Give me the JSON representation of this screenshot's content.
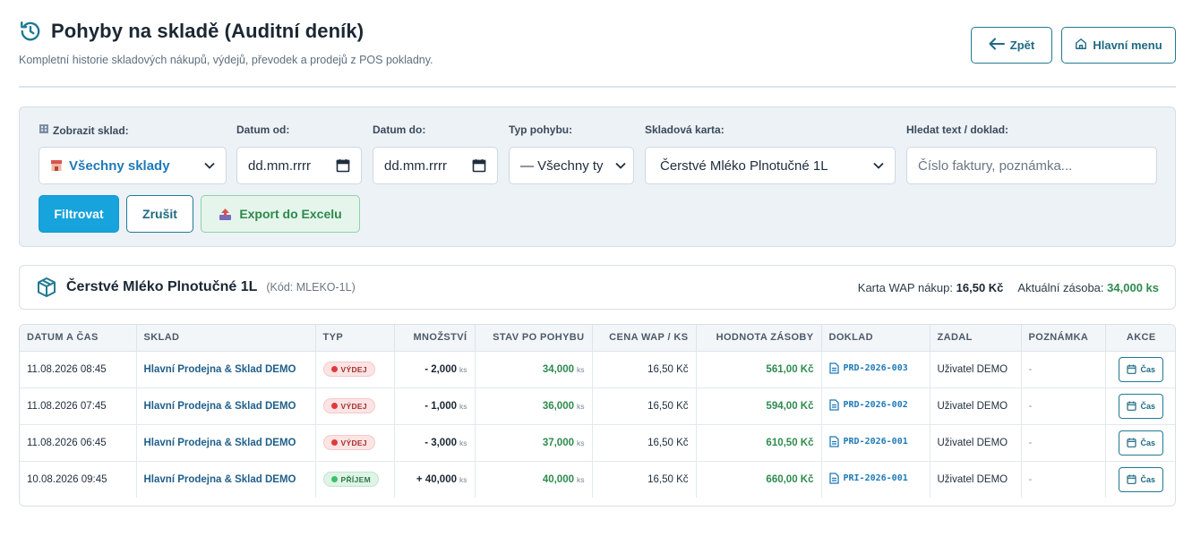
{
  "header": {
    "title": "Pohyby na skladě (Auditní deník)",
    "subtitle": "Kompletní historie skladových nákupů, výdejů, převodek a prodejů z POS pokladny.",
    "back_label": "Zpět",
    "home_label": "Hlavní menu"
  },
  "filters": {
    "store_label": "Zobrazit sklad:",
    "store_value": "Všechny sklady",
    "date_from_label": "Datum od:",
    "date_from_value": "dd.mm.rrrr",
    "date_to_label": "Datum do:",
    "date_to_value": "dd.mm.rrrr",
    "type_label": "Typ pohybu:",
    "type_value": "— Všechny ty",
    "card_label": "Skladová karta:",
    "card_value": "Čerstvé Mléko Plnotučné 1L",
    "search_label": "Hledat text / doklad:",
    "search_placeholder": "Číslo faktury, poznámka...",
    "filter_button": "Filtrovat",
    "cancel_button": "Zrušit",
    "export_button": "Export do Excelu"
  },
  "item": {
    "name": "Čerstvé Mléko Plnotučné 1L",
    "code": "(Kód: MLEKO-1L)",
    "wap_label": "Karta WAP nákup:",
    "wap_value": "16,50 Kč",
    "stock_label": "Aktuální zásoba:",
    "stock_value": "34,000 ks"
  },
  "table": {
    "headers": [
      "DATUM A ČAS",
      "SKLAD",
      "TYP",
      "MNOŽSTVÍ",
      "STAV PO POHYBU",
      "CENA WAP / KS",
      "HODNOTA ZÁSOBY",
      "DOKLAD",
      "ZADAL",
      "POZNÁMKA",
      "AKCE"
    ],
    "unit": "ks",
    "action_label": "Čas",
    "rows": [
      {
        "datetime": "11.08.2026 08:45",
        "store": "Hlavní Prodejna & Sklad DEMO",
        "type": "VÝDEJ",
        "qty": "- 2,000",
        "balance": "34,000",
        "wap": "16,50 Kč",
        "value": "561,00 Kč",
        "doc": "PRD-2026-003",
        "user": "Uživatel DEMO",
        "note": "-"
      },
      {
        "datetime": "11.08.2026 07:45",
        "store": "Hlavní Prodejna & Sklad DEMO",
        "type": "VÝDEJ",
        "qty": "- 1,000",
        "balance": "36,000",
        "wap": "16,50 Kč",
        "value": "594,00 Kč",
        "doc": "PRD-2026-002",
        "user": "Uživatel DEMO",
        "note": "-"
      },
      {
        "datetime": "11.08.2026 06:45",
        "store": "Hlavní Prodejna & Sklad DEMO",
        "type": "VÝDEJ",
        "qty": "- 3,000",
        "balance": "37,000",
        "wap": "16,50 Kč",
        "value": "610,50 Kč",
        "doc": "PRD-2026-001",
        "user": "Uživatel DEMO",
        "note": "-"
      },
      {
        "datetime": "10.08.2026 09:45",
        "store": "Hlavní Prodejna & Sklad DEMO",
        "type": "PŘÍJEM",
        "qty": "+ 40,000",
        "balance": "40,000",
        "wap": "16,50 Kč",
        "value": "660,00 Kč",
        "doc": "PRI-2026-001",
        "user": "Uživatel DEMO",
        "note": "-"
      }
    ]
  },
  "colors": {
    "accent": "#17a3dc",
    "outline": "#1f7a93",
    "success": "#2e8b4e",
    "danger": "#e03b3b"
  }
}
